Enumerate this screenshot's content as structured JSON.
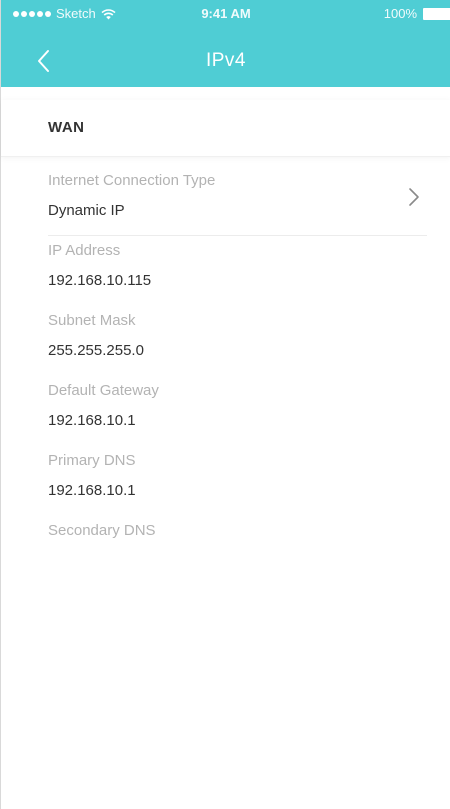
{
  "status_bar": {
    "carrier": "Sketch",
    "time": "9:41 AM",
    "battery": "100%"
  },
  "nav": {
    "title": "IPv4",
    "back_icon": "chevron-left-icon"
  },
  "section": {
    "title": "WAN"
  },
  "fields": [
    {
      "label": "Internet Connection Type",
      "value": "Dynamic IP"
    },
    {
      "label": "IP Address",
      "value": "192.168.10.115"
    },
    {
      "label": "Subnet Mask",
      "value": "255.255.255.0"
    },
    {
      "label": "Default Gateway",
      "value": "192.168.10.1"
    },
    {
      "label": "Primary DNS",
      "value": "192.168.10.1"
    },
    {
      "label": "Secondary DNS",
      "value": ""
    }
  ],
  "colors": {
    "header": "#4fcdd4",
    "label": "#b3b3b3",
    "value": "#333333"
  }
}
